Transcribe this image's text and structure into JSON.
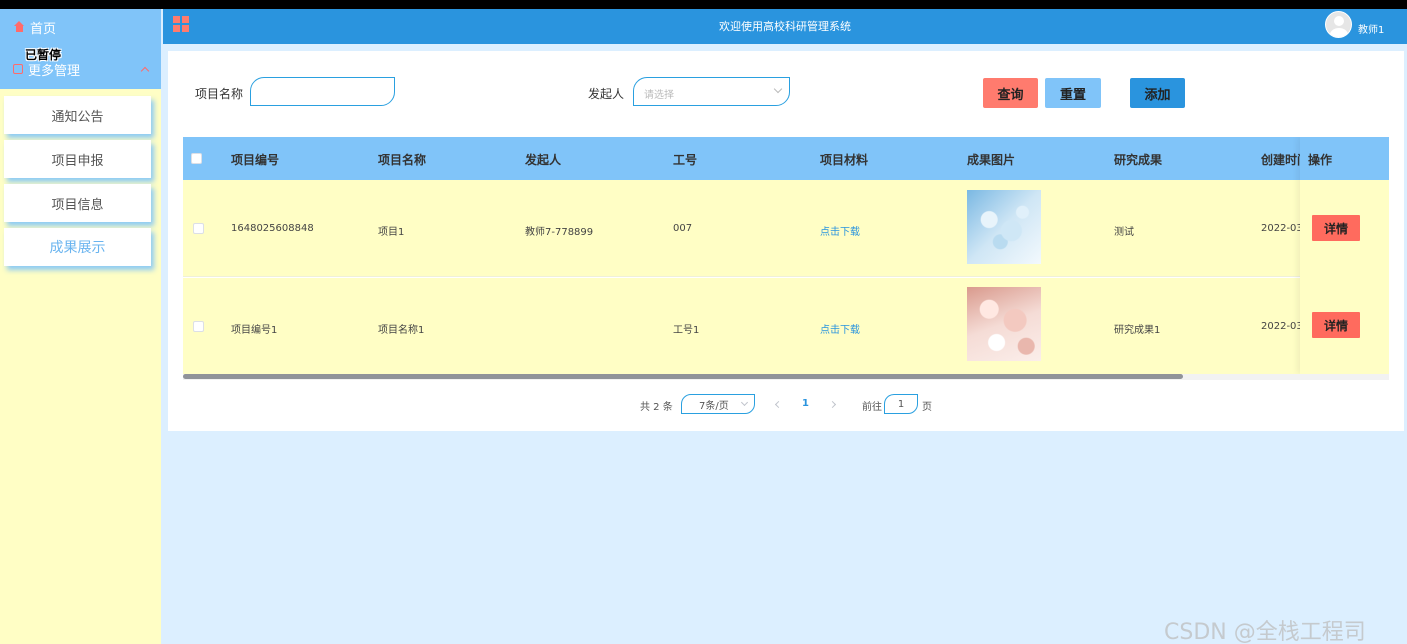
{
  "sidebar": {
    "home": "首页",
    "paused": "已暂停",
    "more": "更多管理",
    "items": [
      {
        "label": "通知公告"
      },
      {
        "label": "项目申报"
      },
      {
        "label": "项目信息"
      },
      {
        "label": "成果展示"
      }
    ]
  },
  "header": {
    "title": "欢迎使用高校科研管理系统",
    "username": "教师1"
  },
  "search": {
    "name_label": "项目名称",
    "name_value": "",
    "initiator_label": "发起人",
    "initiator_placeholder": "请选择",
    "query": "查询",
    "reset": "重置",
    "add": "添加"
  },
  "table": {
    "columns": [
      "项目编号",
      "项目名称",
      "发起人",
      "工号",
      "项目材料",
      "成果图片",
      "研究成果",
      "创建时间",
      "操作"
    ],
    "rows": [
      {
        "code": "1648025608848",
        "name": "项目1",
        "initiator": "教师7-778899",
        "job_no": "007",
        "material": "点击下载",
        "result": "测试",
        "created": "2022-03",
        "action": "详情"
      },
      {
        "code": "项目编号1",
        "name": "项目名称1",
        "initiator": "",
        "job_no": "工号1",
        "material": "点击下载",
        "result": "研究成果1",
        "created": "2022-03",
        "action": "详情"
      }
    ]
  },
  "pagination": {
    "total": "共 2 条",
    "page_size": "7条/页",
    "current": "1",
    "goto_prefix": "前往",
    "goto_value": "1",
    "goto_suffix": "页"
  },
  "watermark": "CSDN @全栈工程司",
  "colors": {
    "header": "#2a94de",
    "sidebar_top": "#80c4f9",
    "sidebar_bg": "#fffec5",
    "table_head": "#80c4f9",
    "danger": "#ff7b6e"
  }
}
